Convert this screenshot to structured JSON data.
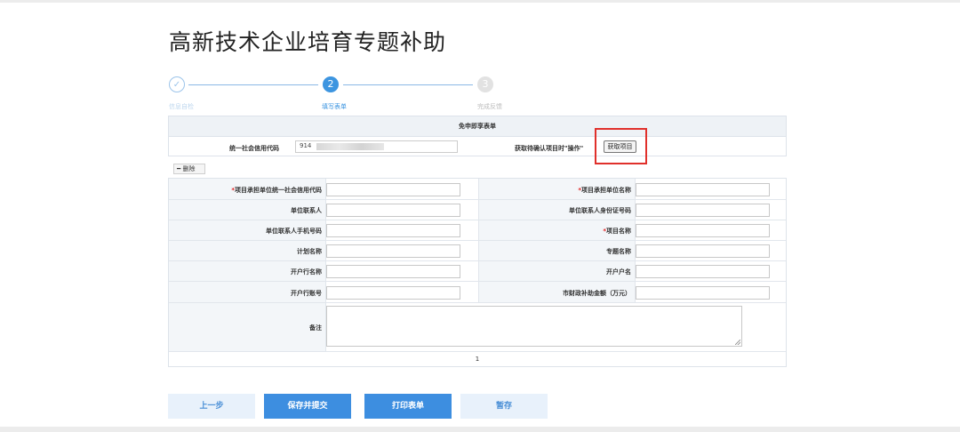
{
  "page": {
    "title": "高新技术企业培育专题补助"
  },
  "stepper": {
    "steps": [
      {
        "number": "✓",
        "label": "信息自检",
        "state": "done"
      },
      {
        "number": "2",
        "label": "填写表单",
        "state": "active"
      },
      {
        "number": "3",
        "label": "完成反馈",
        "state": "pending"
      }
    ]
  },
  "top_form": {
    "header": "免申即享表单",
    "credit_code_label": "统一社会信用代码",
    "credit_code_value": "914",
    "fetch_hint": "获取待确认项目时\"操作\"",
    "fetch_button": "获取项目"
  },
  "grid": {
    "delete_button": "━ 删除",
    "rows": [
      {
        "left_label": "项目承担单位统一社会信用代码",
        "left_required": true,
        "right_label": "项目承担单位名称",
        "right_required": true
      },
      {
        "left_label": "单位联系人",
        "left_required": false,
        "right_label": "单位联系人身份证号码",
        "right_required": false
      },
      {
        "left_label": "单位联系人手机号码",
        "left_required": false,
        "right_label": "项目名称",
        "right_required": true
      },
      {
        "left_label": "计划名称",
        "left_required": false,
        "right_label": "专题名称",
        "right_required": false
      },
      {
        "left_label": "开户行名称",
        "left_required": false,
        "right_label": "开户户名",
        "right_required": false
      },
      {
        "left_label": "开户行账号",
        "left_required": false,
        "right_label": "市财政补助金额（万元）",
        "right_required": false
      }
    ],
    "remark_label": "备注",
    "required_mark": "*",
    "pager": "1"
  },
  "buttons": {
    "prev": "上一步",
    "save_submit": "保存并提交",
    "print": "打印表单",
    "draft": "暂存"
  },
  "colors": {
    "primary": "#3d8ee0",
    "light_button": "#e8f1fb",
    "highlight_box": "#e0302b"
  }
}
